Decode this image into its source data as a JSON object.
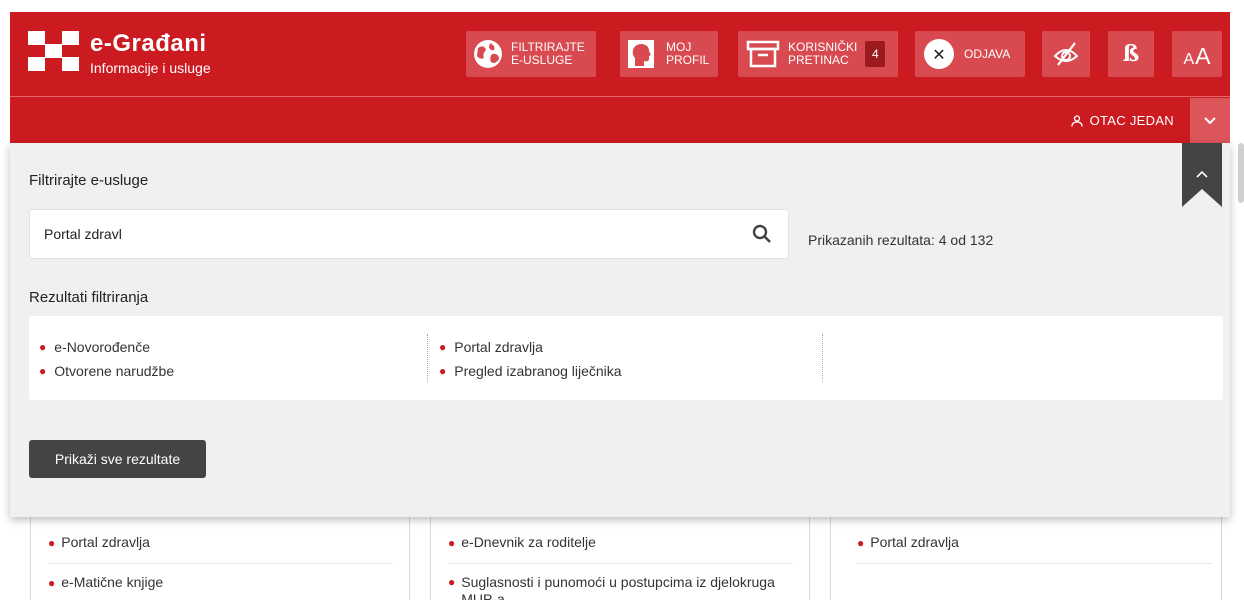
{
  "header": {
    "title": "e-Građani",
    "subtitle": "Informacije i usluge",
    "accent_color": "#cc1a21",
    "buttons": {
      "filter": {
        "line1": "FILTRIRAJTE",
        "line2": "E-USLUGE",
        "icon": "globe-icon"
      },
      "profile": {
        "line1": "MOJ",
        "line2": "PROFIL",
        "icon": "profile-head-icon"
      },
      "inbox": {
        "line1": "KORISNIČKI",
        "line2": "PRETINAC",
        "badge": "4",
        "icon": "inbox-icon"
      },
      "logout": {
        "label": "ODJAVA",
        "icon": "close-circle-icon"
      },
      "visibility": {
        "icon": "eye-off-icon"
      },
      "dyslexic": {
        "label": "ß",
        "icon": "dyslexia-font-icon"
      },
      "fontsize": {
        "label_small": "A",
        "label_large": "A"
      }
    },
    "user": {
      "name": "OTAC JEDAN",
      "icon": "user-icon"
    }
  },
  "panel": {
    "title": "Filtrirajte e-usluge",
    "search": {
      "value": "Portal zdravl",
      "placeholder": ""
    },
    "result_count": "Prikazanih rezultata: 4 od 132",
    "filter_title": "Rezultati filtriranja",
    "results": [
      [
        "e-Novorođenče",
        "Otvorene narudžbe"
      ],
      [
        "Portal zdravlja",
        "Pregled izabranog liječnika"
      ],
      []
    ],
    "show_all": "Prikaži sve rezultate"
  },
  "background": {
    "columns": [
      [
        "Portal zdravlja",
        "e-Matične knjige"
      ],
      [
        "e-Dnevnik za roditelje",
        "Suglasnosti i punomoći u postupcima iz djelokruga MUP-a"
      ],
      [
        "Portal zdravlja"
      ]
    ]
  }
}
